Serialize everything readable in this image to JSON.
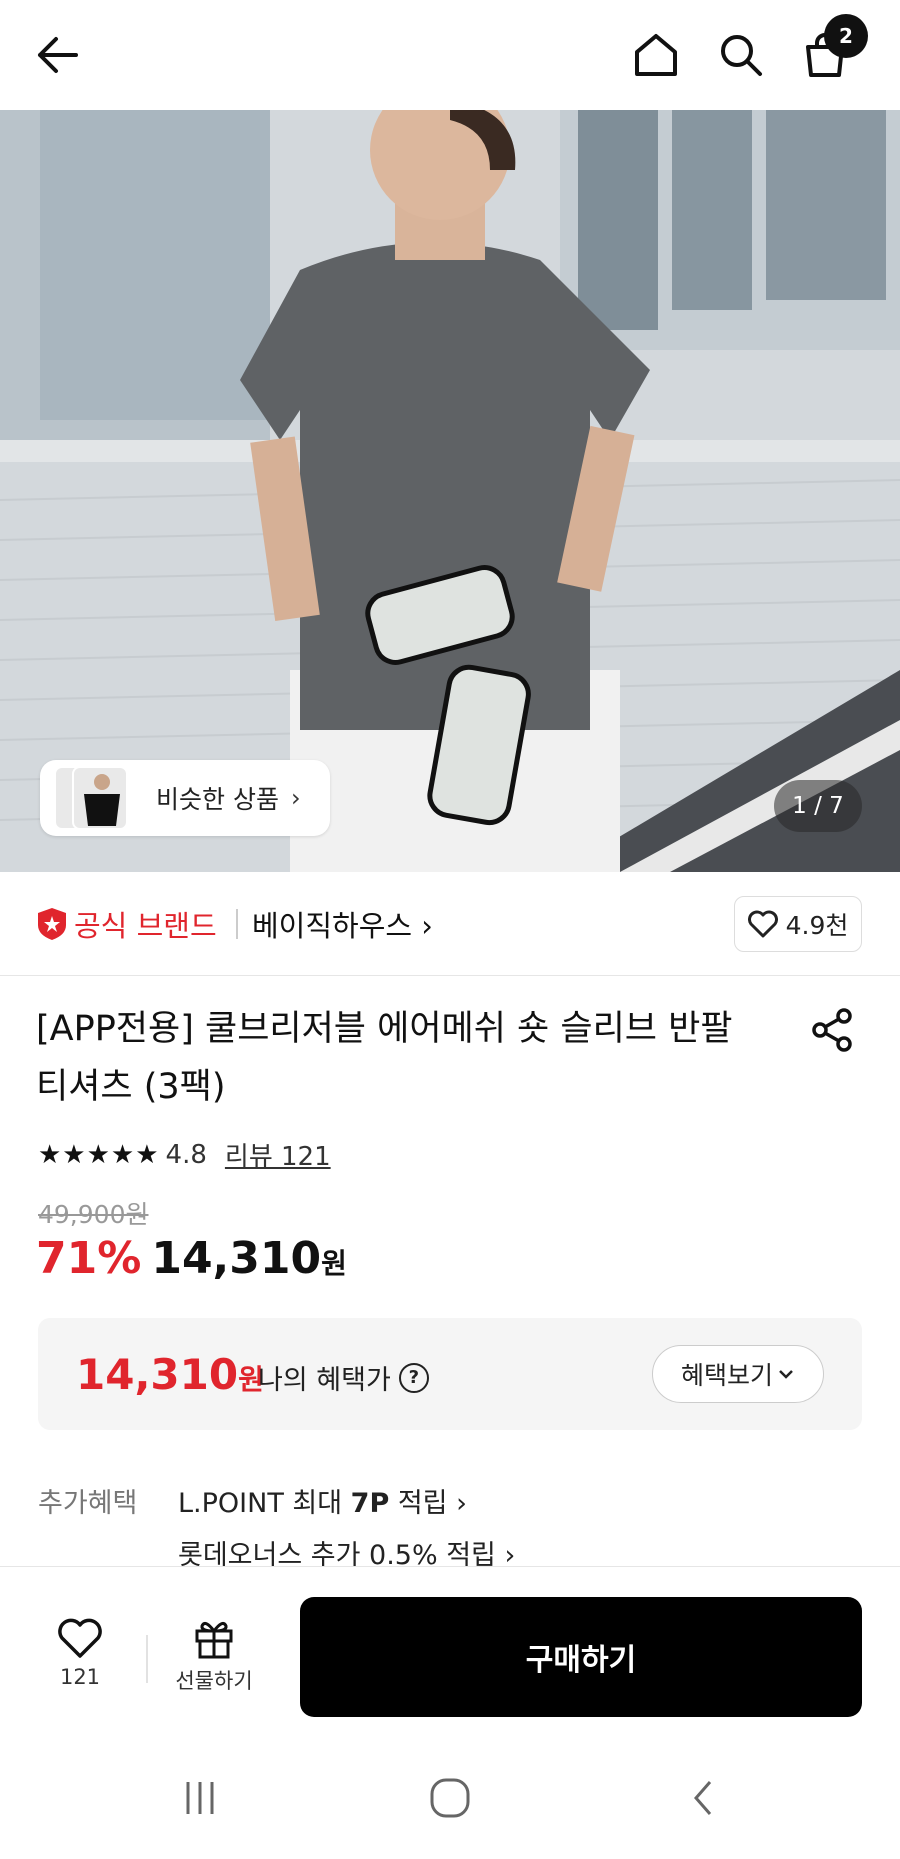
{
  "header": {
    "back_icon": "arrow-left-icon",
    "home_icon": "home-icon",
    "search_icon": "search-icon",
    "cart_icon": "shopping-bag-icon",
    "cart_count": "2"
  },
  "gallery": {
    "similar_label": "비슷한 상품",
    "pager": "1 / 7"
  },
  "brand": {
    "official_label": "공식 브랜드",
    "name": "베이직하우스 ›",
    "likes": "4.9천"
  },
  "product": {
    "title_line1": "[APP전용] 쿨브리저블 에어메쉬 숏 슬리브 반팔",
    "title_line2": "티셔츠 (3팩)",
    "stars": "★★★★★",
    "rating": "4.8",
    "reviews": "리뷰 121",
    "original_price": "49,900원",
    "discount": "71%",
    "price": "14,310",
    "price_unit": "원"
  },
  "benefit": {
    "price": "14,310",
    "unit": "원",
    "label": "나의 혜택가",
    "help": "?",
    "view_button": "혜택보기"
  },
  "extra": {
    "label": "추가혜택",
    "line1_prefix": "L.POINT 최대 ",
    "line1_bold": "7P",
    "line1_suffix": " 적립 ›",
    "line2": "롯데오너스 추가 0.5% 적립 ›"
  },
  "actions": {
    "wish_count": "121",
    "gift_label": "선물하기",
    "buy_label": "구매하기"
  },
  "colors": {
    "accent_red": "#e0252d",
    "buy_button": "#000000"
  }
}
